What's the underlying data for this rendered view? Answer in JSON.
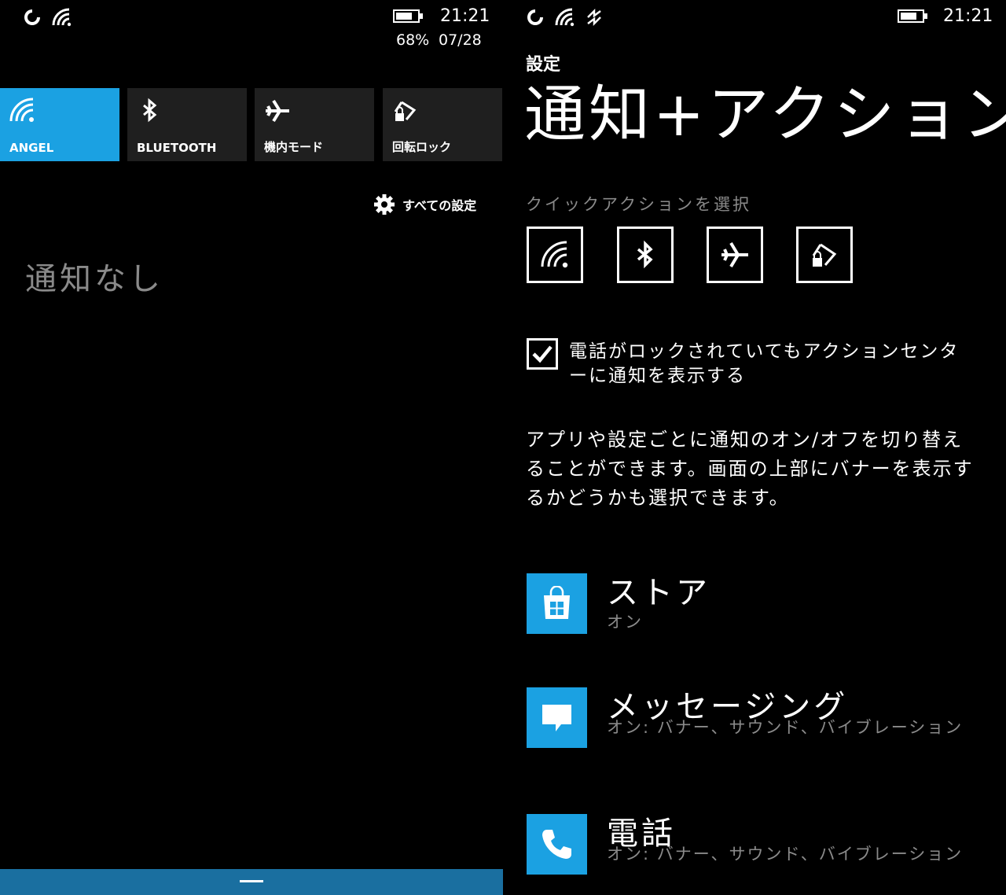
{
  "left": {
    "status": {
      "time": "21:21",
      "battery": "68%",
      "date": "07/28"
    },
    "tiles": [
      {
        "label": "ANGEL",
        "icon": "wifi-icon",
        "active": true
      },
      {
        "label": "BLUETOOTH",
        "icon": "bluetooth-icon",
        "active": false
      },
      {
        "label": "機内モード",
        "icon": "airplane-icon",
        "active": false
      },
      {
        "label": "回転ロック",
        "icon": "rotation-lock-icon",
        "active": false
      }
    ],
    "all_settings": "すべての設定",
    "no_notifications": "通知なし"
  },
  "right": {
    "status": {
      "time": "21:21"
    },
    "settings_label": "設定",
    "page_title": "通知+アクション",
    "quick_actions_label": "クイックアクションを選択",
    "lock_checkbox": {
      "checked": true,
      "label": "電話がロックされていてもアクションセンターに通知を表示する"
    },
    "description": "アプリや設定ごとに通知のオン/オフを切り替えることができます。画面の上部にバナーを表示するかどうかも選択できます。",
    "apps": [
      {
        "name": "ストア",
        "status": "オン",
        "icon": "store-icon"
      },
      {
        "name": "メッセージング",
        "status": "オン: バナー、サウンド、バイブレーション",
        "icon": "messaging-icon"
      },
      {
        "name": "電話",
        "status": "オン: バナー、サウンド、バイブレーション",
        "icon": "phone-icon"
      }
    ]
  },
  "colors": {
    "accent": "#1ba1e2",
    "tile": "#1f1f1f",
    "bottom_bar": "#1a6fa0",
    "muted": "#8a8a8a"
  }
}
